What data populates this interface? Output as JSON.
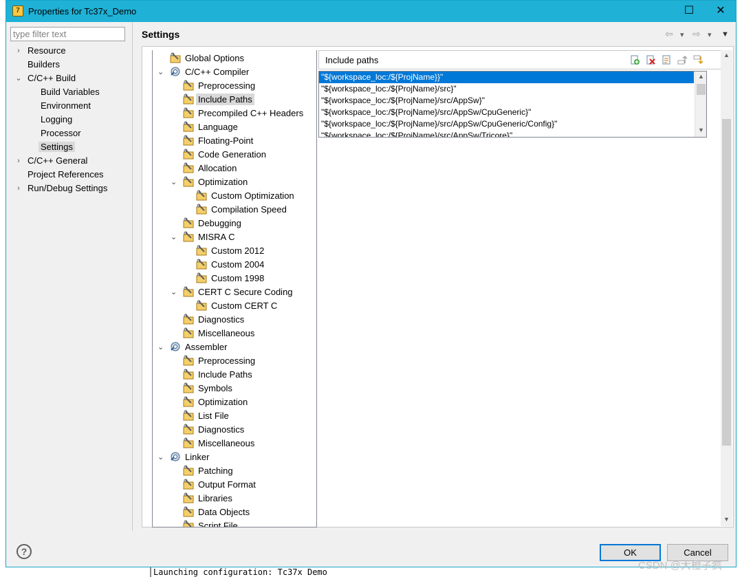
{
  "window": {
    "title": "Properties for Tc37x_Demo",
    "app_icon_glyph": "7",
    "minimize_glyph": "—",
    "maximize_glyph": "☐",
    "close_glyph": "✕"
  },
  "filter": {
    "placeholder": "type filter text",
    "value": ""
  },
  "nav": {
    "items": [
      {
        "label": "Resource",
        "expander": "›"
      },
      {
        "label": "Builders"
      },
      {
        "label": "C/C++ Build",
        "expander": "⌄"
      },
      {
        "label": "Build Variables"
      },
      {
        "label": "Environment"
      },
      {
        "label": "Logging"
      },
      {
        "label": "Processor"
      },
      {
        "label": "Settings",
        "selected": true
      },
      {
        "label": "C/C++ General",
        "expander": "›"
      },
      {
        "label": "Project References"
      },
      {
        "label": "Run/Debug Settings",
        "expander": "›"
      }
    ]
  },
  "page": {
    "title": "Settings",
    "back_glyph": "⇦",
    "forward_glyph": "⇨",
    "dropdown_glyph": "▾",
    "menu_glyph": "▼"
  },
  "tree": {
    "nodes": [
      {
        "label": "Global Options",
        "icon": "tool-settings-icon"
      },
      {
        "label": "C/C++ Compiler",
        "icon": "tool-gear-icon",
        "expander": "⌄"
      },
      {
        "label": "Preprocessing",
        "icon": "tool-settings-icon"
      },
      {
        "label": "Include Paths",
        "icon": "tool-settings-icon",
        "selected": true
      },
      {
        "label": "Precompiled C++ Headers",
        "icon": "tool-settings-icon"
      },
      {
        "label": "Language",
        "icon": "tool-settings-icon"
      },
      {
        "label": "Floating-Point",
        "icon": "tool-settings-icon"
      },
      {
        "label": "Code Generation",
        "icon": "tool-settings-icon"
      },
      {
        "label": "Allocation",
        "icon": "tool-settings-icon"
      },
      {
        "label": "Optimization",
        "icon": "tool-settings-icon",
        "expander": "⌄"
      },
      {
        "label": "Custom Optimization",
        "icon": "tool-settings-icon"
      },
      {
        "label": "Compilation Speed",
        "icon": "tool-settings-icon"
      },
      {
        "label": "Debugging",
        "icon": "tool-settings-icon"
      },
      {
        "label": "MISRA C",
        "icon": "tool-settings-icon",
        "expander": "⌄"
      },
      {
        "label": "Custom 2012",
        "icon": "tool-settings-icon"
      },
      {
        "label": "Custom 2004",
        "icon": "tool-settings-icon"
      },
      {
        "label": "Custom 1998",
        "icon": "tool-settings-icon"
      },
      {
        "label": "CERT C Secure Coding",
        "icon": "tool-settings-icon",
        "expander": "⌄"
      },
      {
        "label": "Custom CERT C",
        "icon": "tool-settings-icon"
      },
      {
        "label": "Diagnostics",
        "icon": "tool-settings-icon"
      },
      {
        "label": "Miscellaneous",
        "icon": "tool-settings-icon"
      },
      {
        "label": "Assembler",
        "icon": "tool-gear-icon",
        "expander": "⌄"
      },
      {
        "label": "Preprocessing",
        "icon": "tool-settings-icon"
      },
      {
        "label": "Include Paths",
        "icon": "tool-settings-icon"
      },
      {
        "label": "Symbols",
        "icon": "tool-settings-icon"
      },
      {
        "label": "Optimization",
        "icon": "tool-settings-icon"
      },
      {
        "label": "List File",
        "icon": "tool-settings-icon"
      },
      {
        "label": "Diagnostics",
        "icon": "tool-settings-icon"
      },
      {
        "label": "Miscellaneous",
        "icon": "tool-settings-icon"
      },
      {
        "label": "Linker",
        "icon": "tool-gear-icon",
        "expander": "⌄"
      },
      {
        "label": "Patching",
        "icon": "tool-settings-icon"
      },
      {
        "label": "Output Format",
        "icon": "tool-settings-icon"
      },
      {
        "label": "Libraries",
        "icon": "tool-settings-icon"
      },
      {
        "label": "Data Objects",
        "icon": "tool-settings-icon"
      },
      {
        "label": "Script File",
        "icon": "tool-settings-icon"
      }
    ]
  },
  "include_paths": {
    "heading": "Include paths",
    "toolbar": [
      "add-icon",
      "delete-icon",
      "edit-icon",
      "move-up-icon",
      "move-down-icon"
    ],
    "rows": [
      "\"${workspace_loc:/${ProjName}}\"",
      "\"${workspace_loc:/${ProjName}/src}\"",
      "\"${workspace_loc:/${ProjName}/src/AppSw}\"",
      "\"${workspace_loc:/${ProjName}/src/AppSw/CpuGeneric}\"",
      "\"${workspace_loc:/${ProjName}/src/AppSw/CpuGeneric/Config}\"",
      "\"${workspace_loc:/${ProjName}/src/AppSw/Tricore}\""
    ],
    "scroll_up_glyph": "▲",
    "scroll_down_glyph": "▼"
  },
  "buttons": {
    "ok": "OK",
    "cancel": "Cancel",
    "help_glyph": "?"
  },
  "background": {
    "console_line": "Launching configuration: Tc37x Demo",
    "left_fragments": [
      "c",
      "e",
      "de",
      "fi",
      "nf",
      "fi",
      "."
    ]
  },
  "watermark": "CSDN @大橙子疯",
  "colors": {
    "titlebar": "#1fb1d6",
    "selection": "#0078d7",
    "tree_selection": "#d9d9d9"
  }
}
